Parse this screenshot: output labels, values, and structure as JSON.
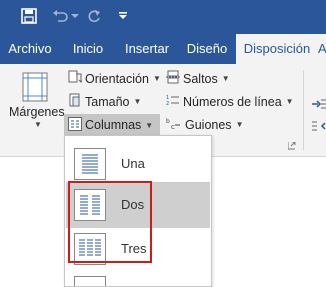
{
  "quick_access": {
    "save_icon": "save-icon",
    "undo_icon": "undo-icon",
    "redo_icon": "redo-icon",
    "customize_icon": "customize-icon"
  },
  "tabs": [
    {
      "label": "Archivo"
    },
    {
      "label": "Inicio"
    },
    {
      "label": "Insertar"
    },
    {
      "label": "Diseño"
    },
    {
      "label": "Disposición",
      "active": true
    }
  ],
  "tab_partial": "Ap",
  "ribbon": {
    "margins_label": "Márgenes",
    "orientation_label": "Orientación",
    "size_label": "Tamaño",
    "columns_label": "Columnas",
    "breaks_label": "Saltos",
    "line_numbers_label": "Números de línea",
    "hyphenation_label": "Guiones"
  },
  "columns_menu": {
    "items": [
      {
        "label": "Una",
        "columns": 1
      },
      {
        "label": "Dos",
        "columns": 2
      },
      {
        "label": "Tres",
        "columns": 3
      }
    ]
  },
  "colors": {
    "titlebar": "#2b579a",
    "ribbon": "#f3f3f3",
    "highlight": "#d11b1b"
  }
}
